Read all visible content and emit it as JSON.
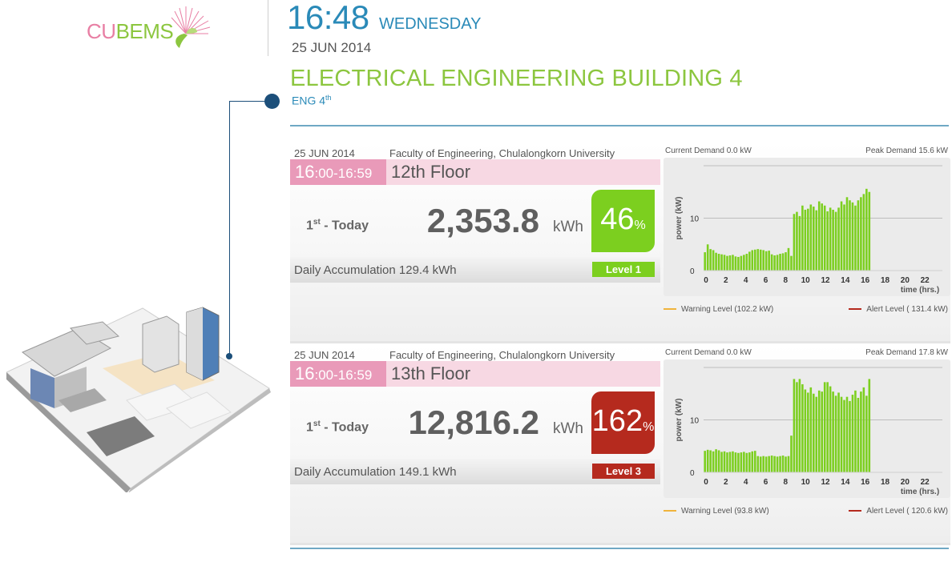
{
  "logo": {
    "part1": "CU",
    "part2": "BEMS"
  },
  "header": {
    "time": "16:48",
    "weekday": "WEDNESDAY",
    "date": "25 JUN 2014",
    "building_title": "ELECTRICAL ENGINEERING BUILDING 4",
    "building_sub": "ENG 4",
    "building_sub_sup": "th"
  },
  "colors": {
    "green": "#8cc63f",
    "blue": "#2a8ab8",
    "pink": "#e99ab9",
    "red": "#b52a1e",
    "warning": "#f0b43c",
    "alert": "#b52a1e"
  },
  "panels": [
    {
      "date": "25 JUN 2014",
      "faculty": "Faculty of Engineering, Chulalongkorn University",
      "time_start": "16",
      "time_rest": ":00-16:59",
      "floor": "12th Floor",
      "rank_num": "1",
      "rank_sup": "st",
      "rank_label": " - Today",
      "energy": "2,353.8",
      "unit": "kWh",
      "percent": "46",
      "percent_sign": "%",
      "percent_color": "#7ccf1f",
      "accumulation": "Daily Accumulation 129.4 kWh",
      "level": "Level 1",
      "level_color": "#7ccf1f",
      "current_demand": "Current Demand 0.0  kW",
      "peak_demand": "Peak Demand 15.6 kW",
      "warning_legend": "Warning Level (102.2 kW)",
      "alert_legend": "Alert Level ( 131.4 kW)"
    },
    {
      "date": "25 JUN 2014",
      "faculty": "Faculty of Engineering, Chulalongkorn University",
      "time_start": "16",
      "time_rest": ":00-16:59",
      "floor": "13th Floor",
      "rank_num": "1",
      "rank_sup": "st",
      "rank_label": " - Today",
      "energy": "12,816.2",
      "unit": "kWh",
      "percent": "162",
      "percent_sign": "%",
      "percent_color": "#b52a1e",
      "accumulation": "Daily Accumulation 149.1 kWh",
      "level": "Level 3",
      "level_color": "#b52a1e",
      "current_demand": "Current Demand 0.0  kW",
      "peak_demand": "Peak Demand 17.8 kW",
      "warning_legend": "Warning Level (93.8 kW)",
      "alert_legend": "Alert Level ( 120.6 kW)"
    }
  ],
  "chart_data": [
    {
      "type": "bar",
      "ylabel": "power (kW)",
      "xlabel": "time (hrs.)",
      "xticks": [
        0,
        2,
        4,
        6,
        8,
        10,
        12,
        14,
        16,
        18,
        20,
        22
      ],
      "yticks": [
        0,
        10
      ],
      "xlim": [
        0,
        24
      ],
      "ylim": [
        0,
        20
      ],
      "bar_color": "#7ccf1f",
      "values": [
        3.5,
        5.0,
        4.1,
        3.9,
        3.4,
        3.2,
        3.1,
        3.0,
        2.8,
        2.9,
        3.0,
        2.7,
        2.6,
        2.8,
        3.0,
        3.2,
        3.6,
        3.9,
        4.0,
        4.1,
        4.0,
        3.9,
        3.7,
        3.8,
        3.1,
        2.9,
        3.0,
        3.2,
        3.3,
        3.5,
        4.3,
        2.8,
        10.8,
        11.2,
        10.4,
        12.4,
        11.6,
        11.8,
        12.6,
        12.2,
        11.5,
        13.2,
        12.8,
        12.4,
        11.3,
        12.0,
        11.6,
        11.2,
        12.0,
        13.2,
        12.6,
        14.0,
        13.4,
        13.0,
        12.4,
        13.4,
        14.0,
        14.6,
        15.6,
        15.0
      ]
    },
    {
      "type": "bar",
      "ylabel": "power (kW)",
      "xlabel": "time (hrs.)",
      "xticks": [
        0,
        2,
        4,
        6,
        8,
        10,
        12,
        14,
        16,
        18,
        20,
        22
      ],
      "yticks": [
        0,
        10
      ],
      "xlim": [
        0,
        24
      ],
      "ylim": [
        0,
        20
      ],
      "bar_color": "#7ccf1f",
      "values": [
        4.1,
        4.3,
        4.2,
        4.0,
        4.4,
        4.2,
        3.9,
        4.0,
        3.8,
        3.9,
        4.0,
        3.8,
        3.7,
        3.8,
        3.9,
        3.7,
        3.8,
        4.0,
        4.1,
        3.1,
        3.0,
        3.1,
        3.0,
        3.1,
        3.2,
        3.1,
        3.0,
        3.1,
        3.2,
        3.0,
        3.1,
        7.0,
        17.8,
        17.2,
        17.8,
        16.8,
        15.8,
        15.2,
        16.2,
        15.0,
        14.4,
        15.6,
        15.4,
        17.2,
        17.2,
        16.4,
        15.4,
        14.6,
        15.2,
        14.4,
        13.8,
        14.4,
        13.6,
        14.8,
        15.6,
        14.2,
        15.4,
        16.2,
        14.6,
        17.8
      ]
    }
  ]
}
